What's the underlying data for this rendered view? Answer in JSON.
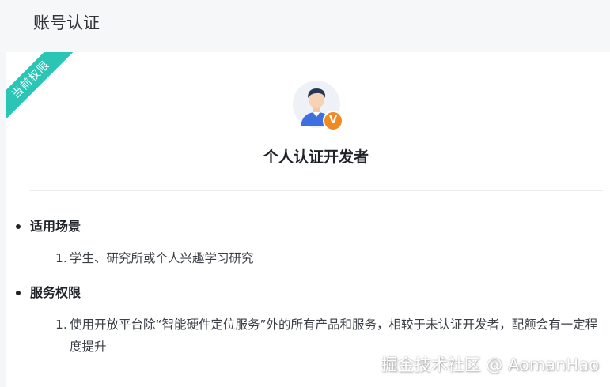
{
  "header": {
    "title": "账号认证"
  },
  "card": {
    "ribbon_label": "当前权限",
    "avatar_icon": "developer-avatar-icon",
    "badge_label": "V",
    "badge_color": "#f08a24",
    "ribbon_color": "#2bc5b6",
    "role_title": "个人认证开发者"
  },
  "sections": [
    {
      "heading": "适用场景",
      "items": [
        {
          "num": "1.",
          "text": "学生、研究所或个人兴趣学习研究"
        }
      ]
    },
    {
      "heading": "服务权限",
      "items": [
        {
          "num": "1.",
          "text": "使用开放平台除“智能硬件定位服务”外的所有产品和服务，相较于未认证开发者，配额会有一定程度提升"
        }
      ]
    }
  ],
  "watermark": "掘金技术社区 @ AomanHao"
}
